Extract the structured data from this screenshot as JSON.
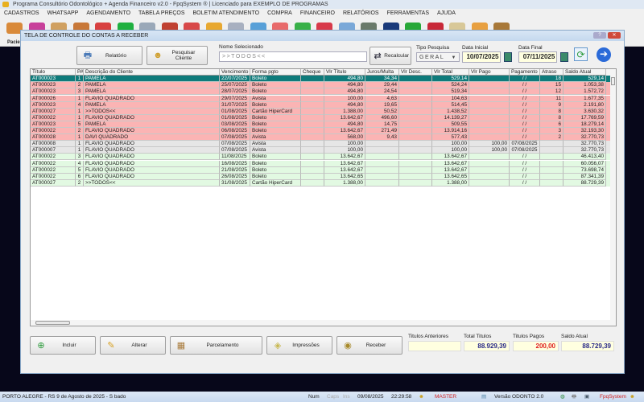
{
  "window": {
    "title": "Programa Consultório Odontológico + Agenda Financeiro v2.0 - FpqSystem ® | Licenciado para  EXEMPLO DE PROGRAMAS"
  },
  "menu": [
    "CADASTROS",
    "WHATSAPP",
    "AGENDAMENTO",
    "TABELA PREÇOS",
    "BOLETIM ATENDIMENTO",
    "COMPRA",
    "FINANCEIRO",
    "RELATÓRIOS",
    "FERRAMENTAS",
    "AJUDA"
  ],
  "toolbar": {
    "first_label": "Pacie",
    "icon_colors": [
      "#d98a3a",
      "#c8409a",
      "#d0a060",
      "#c87838",
      "#d84040",
      "#20b040",
      "#9aa8b8",
      "#c04030",
      "#d84848",
      "#e8a830",
      "#a8b0c0",
      "#58a0d8",
      "#e86a6a",
      "#38b048",
      "#d83a4a",
      "#7aa8d8",
      "#6a7a6a",
      "#1a3a7a",
      "#28a838",
      "#c82838",
      "#d8c898",
      "#e8a040",
      "#a87838"
    ]
  },
  "dialog": {
    "title": "TELA DE CONTROLE DO CONTAS A RECEBER",
    "relatorio": "Relatório",
    "pesquisar": "Pesquisar Cliente",
    "nome_label": "Nome Selecionado",
    "nome_value": ">>TODOS<<",
    "recalcular": "Recalcular",
    "tipo_label": "Tipo  Pesquisa",
    "tipo_value": "GERAL",
    "data_ini_label": "Data Inicial",
    "data_ini": "10/07/2025",
    "data_fim_label": "Data Final",
    "data_fim": "07/11/2025",
    "columns": [
      "Título",
      "PA",
      "Descrição do Cliente",
      "Vencimento",
      "Forma pgto",
      "Cheque",
      "Vlr Título",
      "Juros/Multa",
      "Vlr Desc.",
      "Vlr Total",
      "Vlr Pago",
      "Pagamento",
      "Atraso",
      "Saldo Atual"
    ],
    "rows": [
      {
        "status": "selected",
        "cells": [
          "AT000023",
          "1",
          "PAMELA",
          "22/07/2025",
          "Boleto",
          "",
          "494,80",
          "34,34",
          "",
          "529,14",
          "",
          "/ /",
          "18",
          "529,14"
        ]
      },
      {
        "status": "overdue",
        "cells": [
          "AT000023",
          "2",
          "PAMELA",
          "25/07/2025",
          "Boleto",
          "",
          "494,80",
          "29,44",
          "",
          "524,24",
          "",
          "/ /",
          "15",
          "1.053,38"
        ]
      },
      {
        "status": "overdue",
        "cells": [
          "AT000023",
          "3",
          "PAMELA",
          "28/07/2025",
          "Boleto",
          "",
          "494,80",
          "24,54",
          "",
          "519,34",
          "",
          "/ /",
          "12",
          "1.572,72"
        ]
      },
      {
        "status": "overdue",
        "cells": [
          "AT000026",
          "1",
          "FLAVIO QUADRADO",
          "29/07/2025",
          "Avista",
          "",
          "100,00",
          "4,63",
          "",
          "104,63",
          "",
          "/ /",
          "11",
          "1.677,35"
        ]
      },
      {
        "status": "overdue",
        "cells": [
          "AT000023",
          "4",
          "PAMELA",
          "31/07/2025",
          "Boleto",
          "",
          "494,80",
          "19,65",
          "",
          "514,45",
          "",
          "/ /",
          "9",
          "2.191,80"
        ]
      },
      {
        "status": "overdue",
        "cells": [
          "AT000027",
          "1",
          ">>TODOS<<",
          "01/08/2025",
          "Cartão HiperCard",
          "",
          "1.388,00",
          "50,52",
          "",
          "1.438,52",
          "",
          "/ /",
          "8",
          "3.630,32"
        ]
      },
      {
        "status": "overdue",
        "cells": [
          "AT000022",
          "1",
          "FLAVIO QUADRADO",
          "01/08/2025",
          "Boleto",
          "",
          "13.642,67",
          "496,60",
          "",
          "14.139,27",
          "",
          "/ /",
          "8",
          "17.769,59"
        ]
      },
      {
        "status": "overdue",
        "cells": [
          "AT000023",
          "5",
          "PAMELA",
          "03/08/2025",
          "Boleto",
          "",
          "494,80",
          "14,75",
          "",
          "509,55",
          "",
          "/ /",
          "6",
          "18.279,14"
        ]
      },
      {
        "status": "overdue",
        "cells": [
          "AT000022",
          "2",
          "FLAVIO QUADRADO",
          "06/08/2025",
          "Boleto",
          "",
          "13.642,67",
          "271,49",
          "",
          "13.914,16",
          "",
          "/ /",
          "3",
          "32.193,30"
        ]
      },
      {
        "status": "overdue",
        "cells": [
          "AT000028",
          "1",
          "DAVI QUADRADO",
          "07/08/2025",
          "Avista",
          "",
          "568,00",
          "9,43",
          "",
          "577,43",
          "",
          "/ /",
          "2",
          "32.770,73"
        ]
      },
      {
        "status": "paid",
        "cells": [
          "AT000008",
          "1",
          "FLAVIO QUADRADO",
          "07/08/2025",
          "Avista",
          "",
          "100,00",
          "",
          "",
          "100,00",
          "100,00",
          "07/08/2025",
          "",
          "32.770,73"
        ]
      },
      {
        "status": "paid",
        "cells": [
          "AT000007",
          "1",
          "FLAVIO QUADRADO",
          "07/08/2025",
          "Avista",
          "",
          "100,00",
          "",
          "",
          "100,00",
          "100,00",
          "07/08/2025",
          "",
          "32.770,73"
        ]
      },
      {
        "status": "open",
        "cells": [
          "AT000022",
          "3",
          "FLAVIO QUADRADO",
          "11/08/2025",
          "Boleto",
          "",
          "13.642,67",
          "",
          "",
          "13.642,67",
          "",
          "/ /",
          "",
          "46.413,40"
        ]
      },
      {
        "status": "open",
        "cells": [
          "AT000022",
          "4",
          "FLAVIO QUADRADO",
          "16/08/2025",
          "Boleto",
          "",
          "13.642,67",
          "",
          "",
          "13.642,67",
          "",
          "/ /",
          "",
          "60.056,07"
        ]
      },
      {
        "status": "open",
        "cells": [
          "AT000022",
          "5",
          "FLAVIO QUADRADO",
          "21/08/2025",
          "Boleto",
          "",
          "13.642,67",
          "",
          "",
          "13.642,67",
          "",
          "/ /",
          "",
          "73.698,74"
        ]
      },
      {
        "status": "open",
        "cells": [
          "AT000022",
          "6",
          "FLAVIO QUADRADO",
          "26/08/2025",
          "Boleto",
          "",
          "13.642,65",
          "",
          "",
          "13.642,65",
          "",
          "/ /",
          "",
          "87.341,39"
        ]
      },
      {
        "status": "open",
        "cells": [
          "AT000027",
          "2",
          ">>TODOS<<",
          "31/08/2025",
          "Cartão HiperCard",
          "",
          "1.388,00",
          "",
          "",
          "1.388,00",
          "",
          "/ /",
          "",
          "88.729,39"
        ]
      }
    ],
    "buttons": {
      "incluir": "Incluir",
      "alterar": "Alterar",
      "parcelamento": "Parcelamento",
      "impressoes": "Impressões",
      "receber": "Receber"
    },
    "totals": {
      "anteriores_label": "Titulos Anteriores",
      "anteriores": "",
      "total_label": "Total Titulos",
      "total": "88.929,39",
      "pagos_label": "Titulos Pagos",
      "pagos": "200,00",
      "saldo_label": "Saldo Atual",
      "saldo": "88.729,39"
    }
  },
  "status": {
    "location": "PORTO ALEGRE - RS  9 de Agosto de 2025 - S bado",
    "num": "Num",
    "caps": "Caps",
    "ins": "Ins",
    "date": "09/08/2025",
    "time": "22:29:58",
    "user": "MASTER",
    "version": "Versão ODONTO 2.0",
    "brand": "FpqSystem"
  },
  "colors": {
    "selected": "#0e7b7b",
    "overdue": "#fbb4b4",
    "paid": "#e6e6e6",
    "open": "#e2f9e2",
    "pagos_text": "#e02020",
    "totals_text": "#2a2a88"
  }
}
